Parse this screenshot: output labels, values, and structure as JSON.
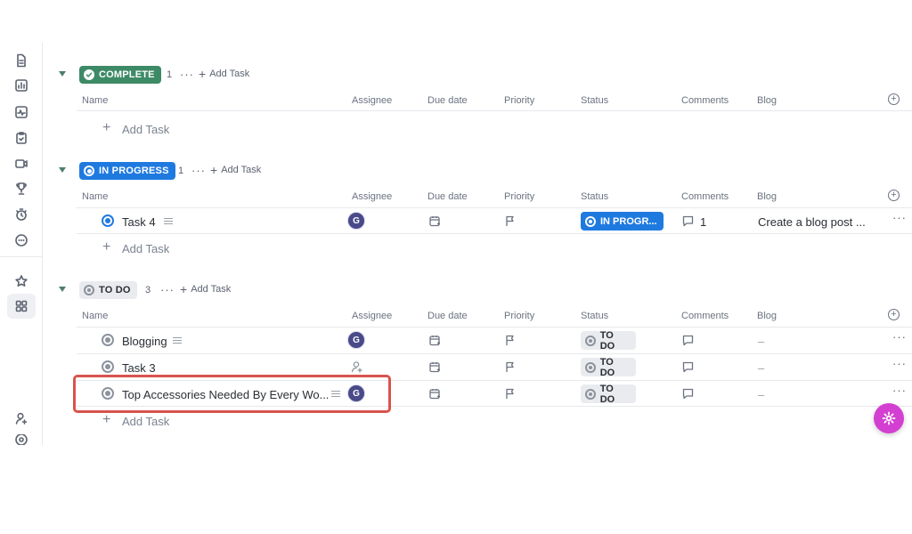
{
  "sidebar": {
    "icons": [
      "doc-icon",
      "chart-icon",
      "pulse-icon",
      "checklist-icon",
      "video-icon",
      "trophy-icon",
      "timer-icon",
      "more-circle-icon",
      "star-icon",
      "grid-icon",
      "user-add-icon",
      "settings-circle-icon"
    ]
  },
  "columns": {
    "name": "Name",
    "assignee": "Assignee",
    "due_date": "Due date",
    "priority": "Priority",
    "status": "Status",
    "comments": "Comments",
    "blog": "Blog"
  },
  "sections": {
    "complete": {
      "label": "COMPLETE",
      "count": "1",
      "add_task": "Add Task",
      "tasks": []
    },
    "in_progress": {
      "label": "IN PROGRESS",
      "count": "1",
      "add_task": "Add Task",
      "tasks": [
        {
          "name": "Task 4",
          "assignee": "G",
          "status": "IN PROGR...",
          "comments": "1",
          "blog": "Create a blog post ..."
        }
      ]
    },
    "todo": {
      "label": "TO DO",
      "count": "3",
      "add_task": "Add Task",
      "tasks": [
        {
          "name": "Blogging",
          "assignee": "G",
          "status": "TO DO",
          "blog": "–"
        },
        {
          "name": "Task 3",
          "assignee": "",
          "status": "TO DO",
          "blog": "–"
        },
        {
          "name": "Top Accessories Needed By Every Wo...",
          "assignee": "G",
          "status": "TO DO",
          "blog": "–"
        }
      ]
    }
  },
  "add_task_row": "Add Task",
  "colors": {
    "complete": "#3d8a66",
    "in_progress": "#1f7ae0",
    "todo": "#e9ebee",
    "highlight": "#d9534f",
    "fab": "#d33fd0"
  }
}
